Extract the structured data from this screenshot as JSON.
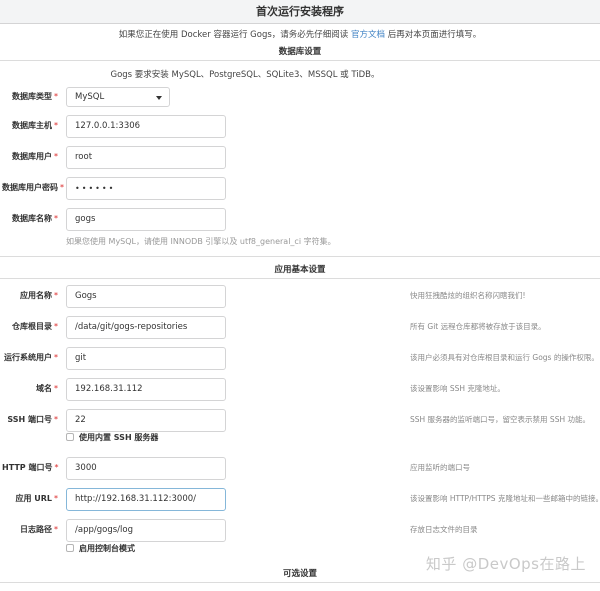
{
  "page": {
    "title": "首次运行安装程序",
    "notice_before": "如果您正在使用 Docker 容器运行 Gogs，请务必先仔细阅读",
    "notice_link": "官方文档",
    "notice_after": "后再对本页面进行填写。"
  },
  "database": {
    "section_title": "数据库设置",
    "intro": "Gogs 要求安装 MySQL、PostgreSQL、SQLite3、MSSQL 或 TiDB。",
    "type_label": "数据库类型",
    "type_value": "MySQL",
    "host_label": "数据库主机",
    "host_value": "127.0.0.1:3306",
    "user_label": "数据库用户",
    "user_value": "root",
    "password_label": "数据库用户密码",
    "password_value": "••••••",
    "name_label": "数据库名称",
    "name_value": "gogs",
    "name_help": "如果您使用 MySQL，请使用 INNODB 引擎以及 utf8_general_ci 字符集。"
  },
  "general": {
    "section_title": "应用基本设置",
    "app_name_label": "应用名称",
    "app_name_value": "Gogs",
    "app_name_help": "快用狂拽酷炫的组织名称闪瞎我们!",
    "repo_root_label": "仓库根目录",
    "repo_root_value": "/data/git/gogs-repositories",
    "repo_root_help": "所有 Git 远程仓库都将被存放于该目录。",
    "run_user_label": "运行系统用户",
    "run_user_value": "git",
    "run_user_help": "该用户必须具有对仓库根目录和运行 Gogs 的操作权限。",
    "domain_label": "域名",
    "domain_value": "192.168.31.112",
    "domain_help": "该设置影响 SSH 克隆地址。",
    "ssh_port_label": "SSH 端口号",
    "ssh_port_value": "22",
    "ssh_port_help": "SSH 服务器的监听端口号，留空表示禁用 SSH 功能。",
    "builtin_ssh_label": "使用内置 SSH 服务器",
    "http_port_label": "HTTP 端口号",
    "http_port_value": "3000",
    "http_port_help": "应用监听的端口号",
    "app_url_label": "应用 URL",
    "app_url_value": "http://192.168.31.112:3000/",
    "app_url_help": "该设置影响 HTTP/HTTPS 克隆地址和一些邮箱中的链接。",
    "log_path_label": "日志路径",
    "log_path_value": "/app/gogs/log",
    "log_path_help": "存放日志文件的目录",
    "console_mode_label": "启用控制台模式"
  },
  "optional": {
    "section_title": "可选设置"
  },
  "watermark": "知乎 @DevOps在路上",
  "colors": {
    "link": "#4183c4",
    "required": "#db2828",
    "focus_border": "#85b7d9"
  }
}
